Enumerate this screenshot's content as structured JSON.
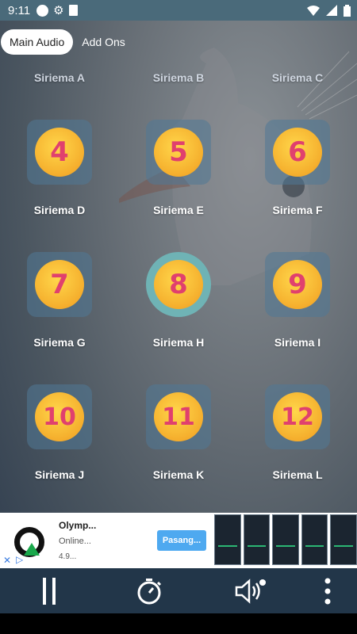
{
  "status_bar": {
    "time": "9:11",
    "left_icons": [
      "circle-icon",
      "gear-icon",
      "sd-card-icon"
    ],
    "right_icons": [
      "wifi-icon",
      "signal-icon",
      "battery-icon"
    ]
  },
  "tabs": [
    {
      "label": "Main Audio",
      "active": true
    },
    {
      "label": "Add Ons",
      "active": false
    }
  ],
  "top_labels": [
    "Siriema A",
    "Siriema B",
    "Siriema C"
  ],
  "items": [
    {
      "number": "4",
      "label": "Siriema D"
    },
    {
      "number": "5",
      "label": "Siriema E"
    },
    {
      "number": "6",
      "label": "Siriema F"
    },
    {
      "number": "7",
      "label": "Siriema G"
    },
    {
      "number": "8",
      "label": "Siriema H"
    },
    {
      "number": "9",
      "label": "Siriema I"
    },
    {
      "number": "10",
      "label": "Siriema J"
    },
    {
      "number": "11",
      "label": "Siriema K"
    },
    {
      "number": "12",
      "label": "Siriema L"
    }
  ],
  "selected_item": "Siriema H",
  "ad": {
    "title": "Olymp...",
    "subtitle": "Online...",
    "rating": "4.9...",
    "button": "Pasang..."
  },
  "bottom_bar": [
    "pause-icon",
    "timer-icon",
    "volume-icon",
    "more-icon"
  ],
  "colors": {
    "accent_coin": "#f7b733",
    "number_color": "#e0406e",
    "bottom_bar": "#223649",
    "selected_ring": "#6fb3b5"
  }
}
